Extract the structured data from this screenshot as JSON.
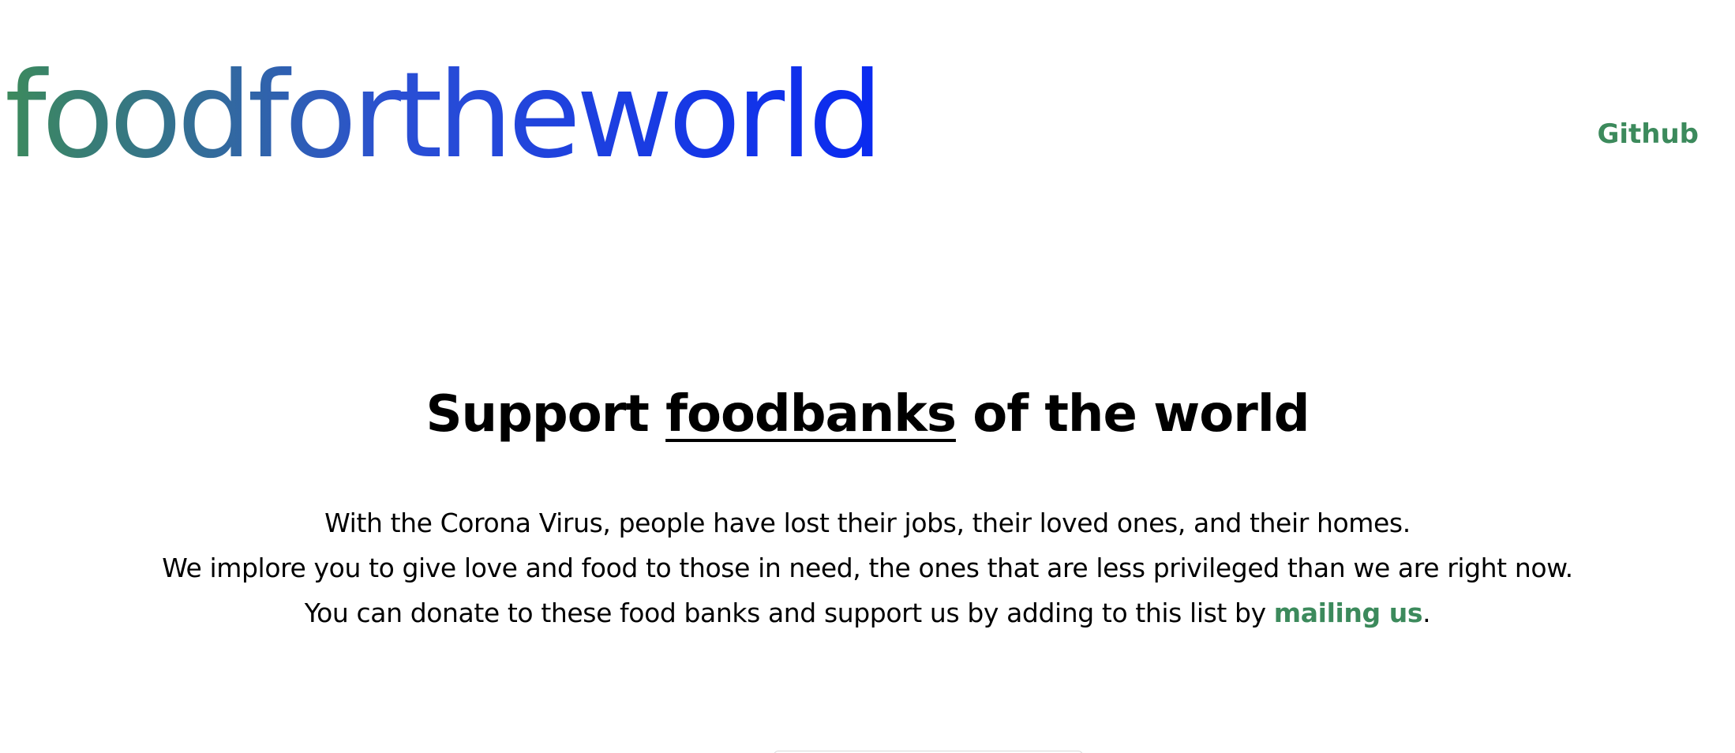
{
  "header": {
    "logo_text": "foodfortheworld",
    "nav_link_label": "Github"
  },
  "hero": {
    "title_before": "Support ",
    "title_underlined": "foodbanks",
    "title_after": " of the world",
    "lines": [
      "With the Corona Virus, people have lost their jobs, their loved ones, and their homes.",
      "We implore you to give love and food to those in need, the ones that are less privileged than we are right now.",
      "You can donate to these food banks and support us by adding to this list by "
    ],
    "mail_link_label": "mailing us",
    "line3_end": "."
  },
  "colors": {
    "accent_green": "#3c8a5c",
    "logo_gradient_start": "#3c8a5c",
    "logo_gradient_end": "#0a2af0",
    "text": "#000000",
    "background": "#ffffff"
  }
}
